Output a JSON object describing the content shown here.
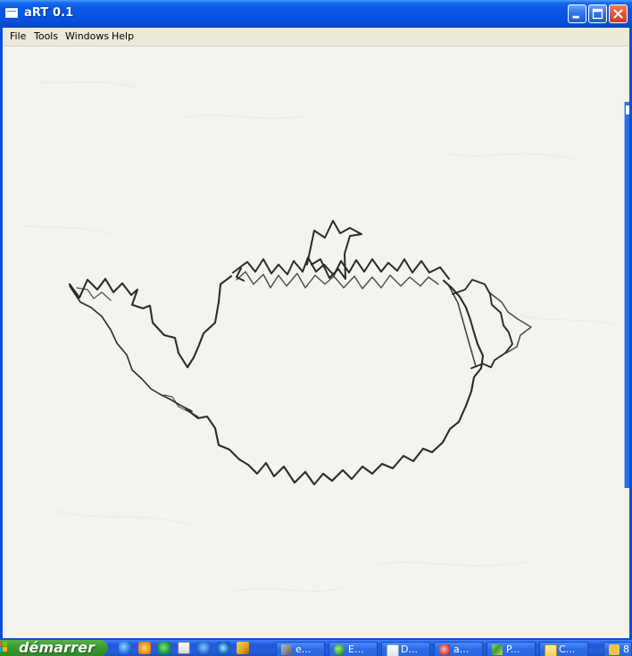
{
  "window": {
    "title": "aRT 0.1",
    "buttons": {
      "minimize_icon": "minimize-icon",
      "maximize_icon": "maximize-icon",
      "close_icon": "close-icon"
    }
  },
  "menubar": {
    "items": [
      "File",
      "Tools",
      "Windows",
      "Help"
    ]
  },
  "canvas": {
    "drawing": "teapot-sketch",
    "background_color": "#f4f3ef",
    "stroke_color": "#2b2b2b"
  },
  "taskbar": {
    "start_label": "démarrer",
    "quick_launch": [
      "internet-explorer-icon",
      "media-player-icon",
      "nero-icon",
      "mail-icon",
      "messenger-icon",
      "network-icon",
      "pencil-icon"
    ],
    "tasks": [
      {
        "label": "e...",
        "icon": "pickaxe-icon"
      },
      {
        "label": "E...",
        "icon": "green-orb-icon"
      },
      {
        "label": "D...",
        "icon": "document-icon"
      },
      {
        "label": "a...",
        "icon": "art-app-icon"
      },
      {
        "label": "P...",
        "icon": "paint-icon"
      },
      {
        "label": "C...",
        "icon": "folder-icon"
      }
    ],
    "tray_label": "8"
  },
  "colors": {
    "title_blue": "#0a54e3",
    "menu_bg": "#ece9d8",
    "start_green": "#3a9c32",
    "close_red": "#e35b3b"
  }
}
